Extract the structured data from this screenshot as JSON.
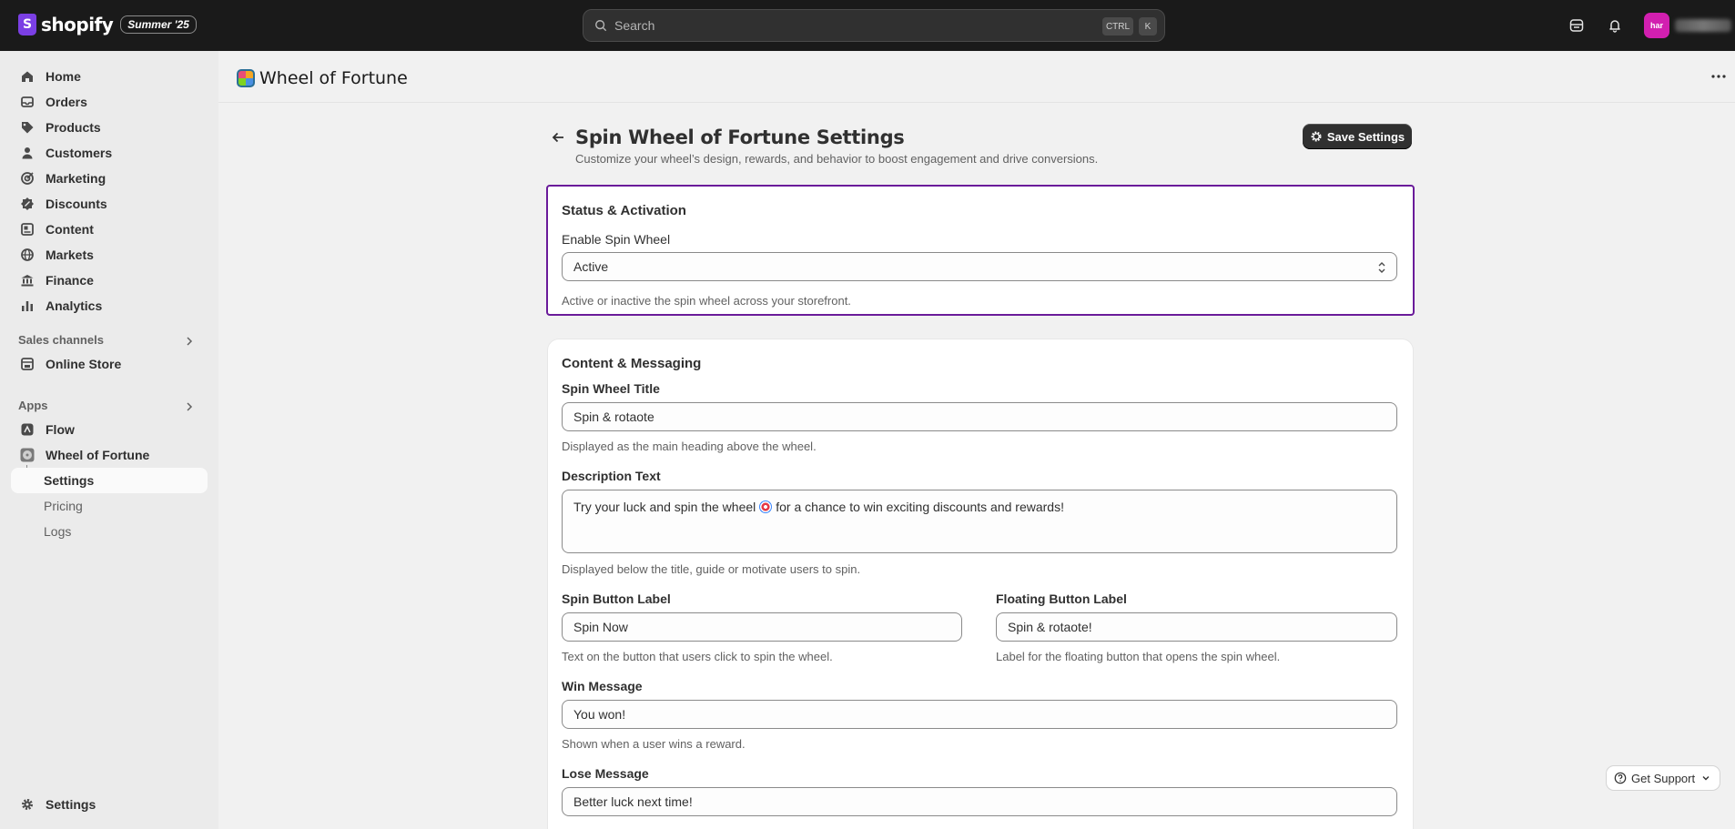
{
  "topbar": {
    "logo_text": "shopify",
    "edition_badge": "Summer '25",
    "search_placeholder": "Search",
    "kbd_ctrl": "CTRL",
    "kbd_k": "K",
    "avatar_initials": "har"
  },
  "sidebar": {
    "items": [
      {
        "label": "Home",
        "icon": "home-icon"
      },
      {
        "label": "Orders",
        "icon": "orders-icon"
      },
      {
        "label": "Products",
        "icon": "tag-icon"
      },
      {
        "label": "Customers",
        "icon": "person-icon"
      },
      {
        "label": "Marketing",
        "icon": "target-icon"
      },
      {
        "label": "Discounts",
        "icon": "discount-icon"
      },
      {
        "label": "Content",
        "icon": "content-icon"
      },
      {
        "label": "Markets",
        "icon": "globe-icon"
      },
      {
        "label": "Finance",
        "icon": "bank-icon"
      },
      {
        "label": "Analytics",
        "icon": "bar-chart-icon"
      }
    ],
    "sales_channels_title": "Sales channels",
    "online_store": "Online Store",
    "apps_title": "Apps",
    "flow": "Flow",
    "wheel_of_fortune": "Wheel of Fortune",
    "sub_settings": "Settings",
    "sub_pricing": "Pricing",
    "sub_logs": "Logs",
    "settings": "Settings"
  },
  "app_header": {
    "title": "Wheel of Fortune"
  },
  "page": {
    "title": "Spin Wheel of Fortune Settings",
    "subtitle": "Customize your wheel’s design, rewards, and behavior to boost engagement and drive conversions.",
    "save_label": "Save Settings"
  },
  "status_card": {
    "title": "Status & Activation",
    "enable_label": "Enable Spin Wheel",
    "enable_value": "Active",
    "enable_help": "Active or inactive the spin wheel across your storefront."
  },
  "content_card": {
    "title": "Content & Messaging",
    "title_label": "Spin Wheel Title",
    "title_value": "Spin & rotaote",
    "title_help": "Displayed as the main heading above the wheel.",
    "desc_label": "Description Text",
    "desc_value_before": "Try your luck and spin the wheel",
    "desc_value_after": "for a chance to win exciting discounts and rewards!",
    "desc_help": "Displayed below the title, guide or motivate users to spin.",
    "spin_btn_label": "Spin Button Label",
    "spin_btn_value": "Spin Now",
    "spin_btn_help": "Text on the button that users click to spin the wheel.",
    "float_btn_label": "Floating Button Label",
    "float_btn_value": "Spin & rotaote!",
    "float_btn_help": "Label for the floating button that opens the spin wheel.",
    "win_label": "Win Message",
    "win_value": "You won!",
    "win_help": "Shown when a user wins a reward.",
    "lose_label": "Lose Message",
    "lose_value": "Better luck next time!"
  },
  "support": {
    "label": "Get Support"
  },
  "colors": {
    "topbar": "#1a1a1a",
    "highlight_outline": "#6a1b9a",
    "avatar": "#d21fb0"
  }
}
